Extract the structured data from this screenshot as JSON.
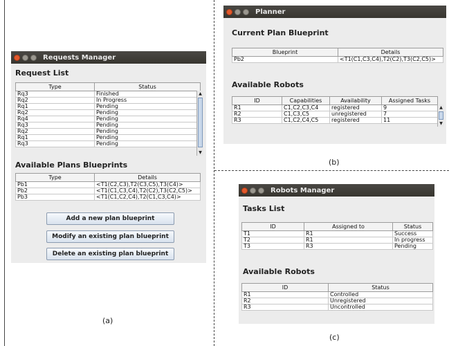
{
  "requests_manager": {
    "title": "Requests Manager",
    "request_list_heading": "Request List",
    "columns": [
      "Type",
      "Status"
    ],
    "rows": [
      [
        "Rq3",
        "Finished"
      ],
      [
        "Rq2",
        "In Progress"
      ],
      [
        "Rq1",
        "Pending"
      ],
      [
        "Rq2",
        "Pending"
      ],
      [
        "Rq4",
        "Pending"
      ],
      [
        "Rq3",
        "Pending"
      ],
      [
        "Rq2",
        "Pending"
      ],
      [
        "Rq1",
        "Pending"
      ],
      [
        "Rq3",
        "Pending"
      ]
    ],
    "blueprints_heading": "Available Plans Blueprints",
    "blueprint_columns": [
      "Type",
      "Details"
    ],
    "blueprint_rows": [
      [
        "Pb1",
        "<T1(C2,C3),T2(C3,C5),T3(C4)>"
      ],
      [
        "Pb2",
        "<T1(C1,C3,C4),T2(C2),T3(C2,C5)>"
      ],
      [
        "Pb3",
        "<T1(C1,C2,C4),T2(C1,C3,C4)>"
      ]
    ],
    "buttons": {
      "add": "Add a new plan blueprint",
      "modify": "Modify an existing plan blueprint",
      "delete": "Delete an existing plan blueprint"
    },
    "caption": "(a)"
  },
  "planner": {
    "title": "Planner",
    "current_heading": "Current Plan Blueprint",
    "current_columns": [
      "Blueprint",
      "Details"
    ],
    "current_rows": [
      [
        "Pb2",
        "<T1(C1,C3,C4),T2(C2),T3(C2,C5)>"
      ]
    ],
    "robots_heading": "Available Robots",
    "robot_columns": [
      "ID",
      "Capabilities",
      "Availability",
      "Assigned Tasks"
    ],
    "robot_rows": [
      [
        "R1",
        "C1,C2,C3,C4",
        "registered",
        "9"
      ],
      [
        "R2",
        "C1,C3,C5",
        "unregistered",
        "7"
      ],
      [
        "R3",
        "C1,C2,C4,C5",
        "registered",
        "11"
      ]
    ],
    "caption": "(b)"
  },
  "robots_manager": {
    "title": "Robots Manager",
    "tasks_heading": "Tasks List",
    "task_columns": [
      "ID",
      "Assigned to",
      "Status"
    ],
    "task_rows": [
      [
        "T1",
        "R1",
        "Success"
      ],
      [
        "T2",
        "R1",
        "In progress"
      ],
      [
        "T3",
        "R3",
        "Pending"
      ]
    ],
    "robots_heading": "Available Robots",
    "robot_columns": [
      "ID",
      "Status"
    ],
    "robot_rows": [
      [
        "R1",
        "Controlled"
      ],
      [
        "R2",
        "Unregistered"
      ],
      [
        "R3",
        "Uncontrolled"
      ]
    ],
    "caption": "(c)"
  },
  "icons": {
    "close": "close-icon",
    "minimize": "minimize-icon",
    "maximize": "maximize-icon",
    "scroll_up": "scroll-up-arrow-icon",
    "scroll_down": "scroll-down-arrow-icon"
  },
  "colors": {
    "titlebar": "#3c3b37",
    "close_button": "#e3592c",
    "window_bg": "#ececec",
    "button_bg": "#dce6f1"
  }
}
